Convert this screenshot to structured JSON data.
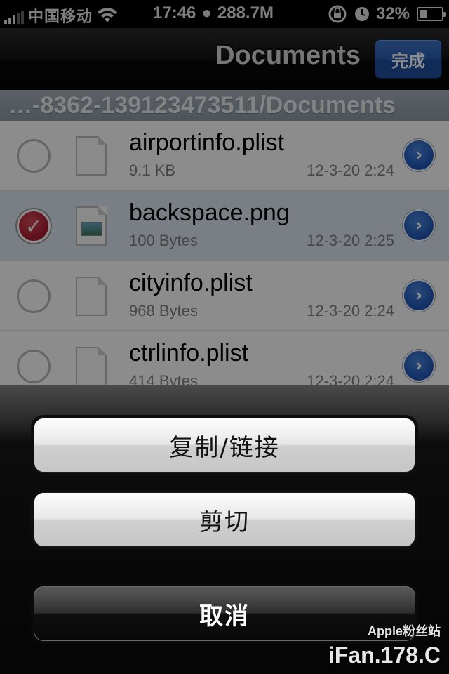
{
  "status_bar": {
    "carrier": "中国移动",
    "time": "17:46",
    "memory": "288.7M",
    "battery_percent": "32%",
    "battery_level": 0.32,
    "icons": [
      "signal-bars-icon",
      "wifi-icon",
      "apple-icon",
      "rotation-lock-icon",
      "clock-icon",
      "battery-charging-icon"
    ]
  },
  "navbar": {
    "title": "Documents",
    "done_label": "完成"
  },
  "path": "…-8362-139123473511/Documents",
  "files": [
    {
      "name": "airportinfo.plist",
      "size": "9.1 KB",
      "date": "12-3-20 2:24",
      "selected": false,
      "thumb": false
    },
    {
      "name": "backspace.png",
      "size": "100 Bytes",
      "date": "12-3-20 2:25",
      "selected": true,
      "thumb": true
    },
    {
      "name": "cityinfo.plist",
      "size": "968 Bytes",
      "date": "12-3-20 2:24",
      "selected": false,
      "thumb": false
    },
    {
      "name": "ctrlinfo.plist",
      "size": "414 Bytes",
      "date": "12-3-20 2:24",
      "selected": false,
      "thumb": false
    }
  ],
  "action_sheet": {
    "copy_link_label": "复制/链接",
    "cut_label": "剪切",
    "cancel_label": "取消"
  },
  "watermark": {
    "site": "iFan.178.C",
    "small": "Apple粉丝站"
  }
}
